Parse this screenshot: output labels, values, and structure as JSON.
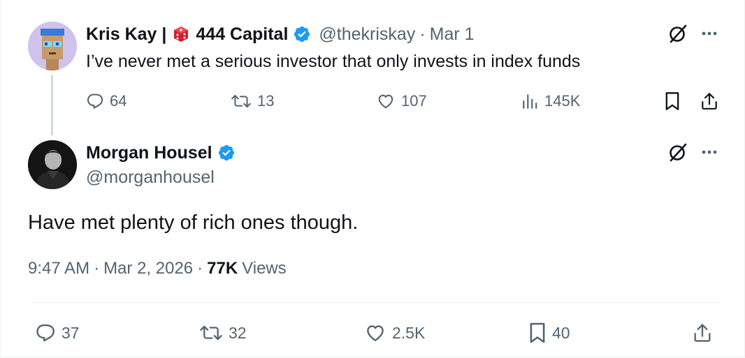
{
  "colors": {
    "verified": "#1d9bf0",
    "text": "#0f1419",
    "muted": "#536471",
    "divider": "#eff3f4",
    "accent_red": "#c8102e"
  },
  "parent_tweet": {
    "author_name": "Kris Kay |",
    "author_org": "444 Capital",
    "handle": "@thekriskay",
    "separator": "·",
    "date": "Mar 1",
    "text": "I’ve never met a serious investor that only invests in index funds",
    "replies": "64",
    "reposts": "13",
    "likes": "107",
    "views": "145K"
  },
  "main_tweet": {
    "author_name": "Morgan Housel",
    "handle": "@morganhousel",
    "text": "Have met plenty of rich ones though.",
    "time": "9:47 AM",
    "sep1": "·",
    "date": "Mar 2, 2026",
    "sep2": "·",
    "views_count": "77K",
    "views_label": "Views",
    "replies": "37",
    "reposts": "32",
    "likes": "2.5K",
    "bookmarks": "40"
  }
}
